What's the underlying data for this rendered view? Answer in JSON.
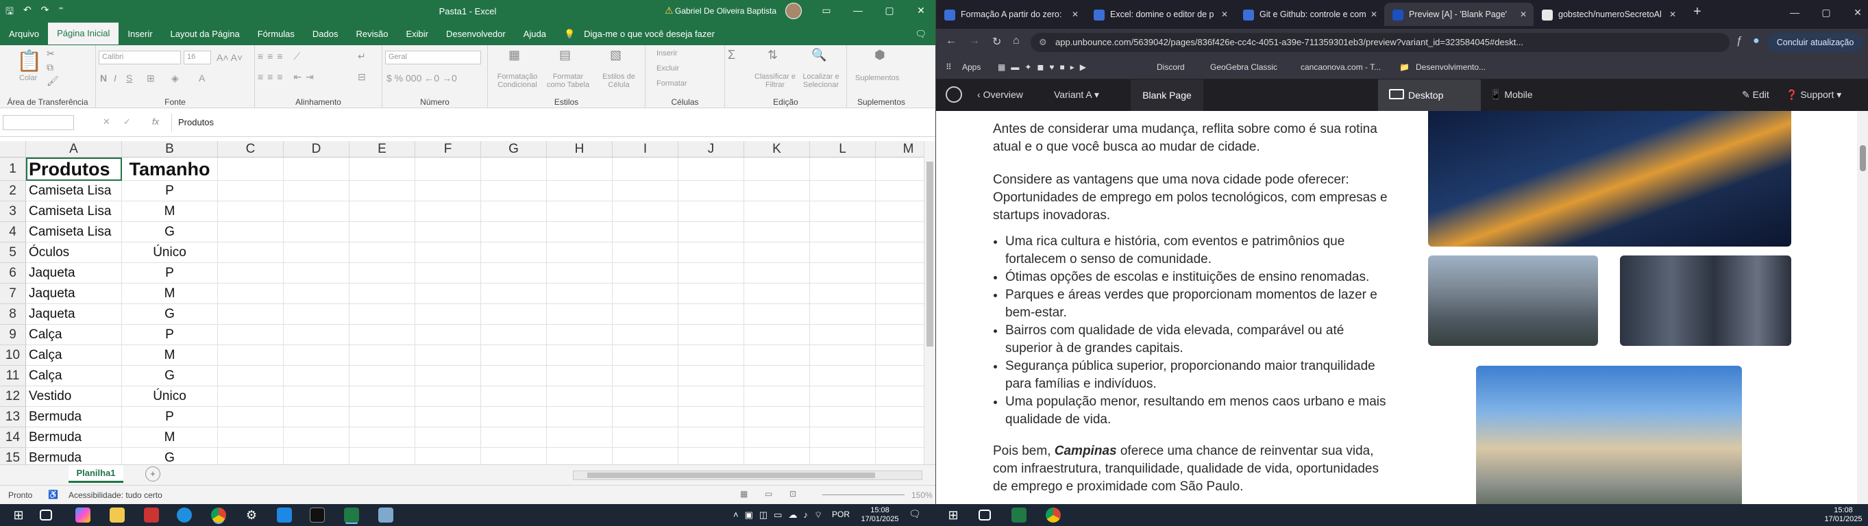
{
  "excel": {
    "title": "Pasta1 - Excel",
    "user_name": "Gabriel De Oliveira Baptista",
    "menu": [
      "Arquivo",
      "Página Inicial",
      "Inserir",
      "Layout da Página",
      "Fórmulas",
      "Dados",
      "Revisão",
      "Exibir",
      "Desenvolvedor",
      "Ajuda"
    ],
    "tell_me": "Diga-me o que você deseja fazer",
    "ribbon": {
      "colar": "Colar",
      "font_name": "Calibri",
      "font_size": "16",
      "number_format": "Geral",
      "formatacao": "Formatação Condicional",
      "formatar_tabela": "Formatar como Tabela",
      "estilos_celula": "Estilos de Célula",
      "inserir": "Inserir",
      "excluir": "Excluir",
      "formatar": "Formatar",
      "classificar": "Classificar e Filtrar",
      "localizar": "Localizar e Selecionar",
      "suplementos": "Suplementos",
      "groups": [
        "Área de Transferência",
        "Fonte",
        "Alinhamento",
        "Número",
        "Estilos",
        "Células",
        "Edição",
        "Suplementos"
      ]
    },
    "formula_bar": {
      "fx": "fx",
      "value": "Produtos"
    },
    "columns": [
      "A",
      "B",
      "C",
      "D",
      "E",
      "F",
      "G",
      "H",
      "I",
      "J",
      "K",
      "L",
      "M"
    ],
    "rows": [
      {
        "n": "1",
        "a": "Produtos",
        "b": "Tamanho"
      },
      {
        "n": "2",
        "a": "Camiseta Lisa",
        "b": "P"
      },
      {
        "n": "3",
        "a": "Camiseta Lisa",
        "b": "M"
      },
      {
        "n": "4",
        "a": "Camiseta Lisa",
        "b": "G"
      },
      {
        "n": "5",
        "a": "Óculos",
        "b": "Único"
      },
      {
        "n": "6",
        "a": "Jaqueta",
        "b": "P"
      },
      {
        "n": "7",
        "a": "Jaqueta",
        "b": "M"
      },
      {
        "n": "8",
        "a": "Jaqueta",
        "b": "G"
      },
      {
        "n": "9",
        "a": "Calça",
        "b": "P"
      },
      {
        "n": "10",
        "a": "Calça",
        "b": "M"
      },
      {
        "n": "11",
        "a": "Calça",
        "b": "G"
      },
      {
        "n": "12",
        "a": "Vestido",
        "b": "Único"
      },
      {
        "n": "13",
        "a": "Bermuda",
        "b": "P"
      },
      {
        "n": "14",
        "a": "Bermuda",
        "b": "M"
      },
      {
        "n": "15",
        "a": "Bermuda",
        "b": "G"
      }
    ],
    "sheet_tab": "Planilha1",
    "status": {
      "ready": "Pronto",
      "accessibility": "Acessibilidade: tudo certo",
      "zoom": "150%"
    }
  },
  "browser": {
    "tabs": [
      {
        "title": "Formação A partir do zero: ",
        "color": "#3b6fd8"
      },
      {
        "title": "Excel: domine o editor de p",
        "color": "#3b6fd8"
      },
      {
        "title": "Git e Github: controle e com",
        "color": "#3b6fd8"
      },
      {
        "title": "Preview [A] - 'Blank Page'",
        "color": "#1e4fbf"
      },
      {
        "title": "gobstech/numeroSecretoAl",
        "color": "#e8e8e8"
      }
    ],
    "url": "app.unbounce.com/5639042/pages/836f426e-cc4c-4051-a39e-711359301eb3/preview?variant_id=323584045#deskt...",
    "concluir": "Concluir atualização",
    "bookmarks": [
      "Apps",
      "Discord",
      "GeoGebra Classic",
      "cancaonova.com - T...",
      "Desenvolvimento..."
    ],
    "unbounce": {
      "overview": "Overview",
      "variant": "Variant A",
      "page": "Blank Page",
      "desktop": "Desktop",
      "mobile": "Mobile",
      "edit": "Edit",
      "support": "Support"
    },
    "content": {
      "p1": "Antes de considerar uma mudança, reflita sobre como é sua rotina atual e o que você busca ao mudar de cidade.",
      "p2": "Considere as vantagens que uma nova cidade pode oferecer: Oportunidades de emprego em polos tecnológicos, com empresas e startups inovadoras.",
      "bullets": [
        "Uma rica cultura e história, com eventos e patrimônios que fortalecem o senso de comunidade.",
        "Ótimas opções de escolas e instituições de ensino renomadas.",
        "Parques e áreas verdes que proporcionam momentos de lazer e bem-estar.",
        "Bairros com qualidade de vida elevada, comparável ou até superior à de grandes capitais.",
        "Segurança pública superior, proporcionando maior tranquilidade para famílias e indivíduos.",
        "Uma população menor, resultando em menos caos urbano e mais qualidade de vida."
      ],
      "p3_start": "Pois bem, ",
      "p3_city": "Campinas",
      "p3_end": " oferece uma chance de reinventar sua vida, com infraestrutura, tranquilidade, qualidade de vida, oportunidades de emprego e proximidade com São Paulo."
    }
  },
  "taskbar": {
    "lang": "POR",
    "time": "15:08",
    "date": "17/01/2025"
  }
}
